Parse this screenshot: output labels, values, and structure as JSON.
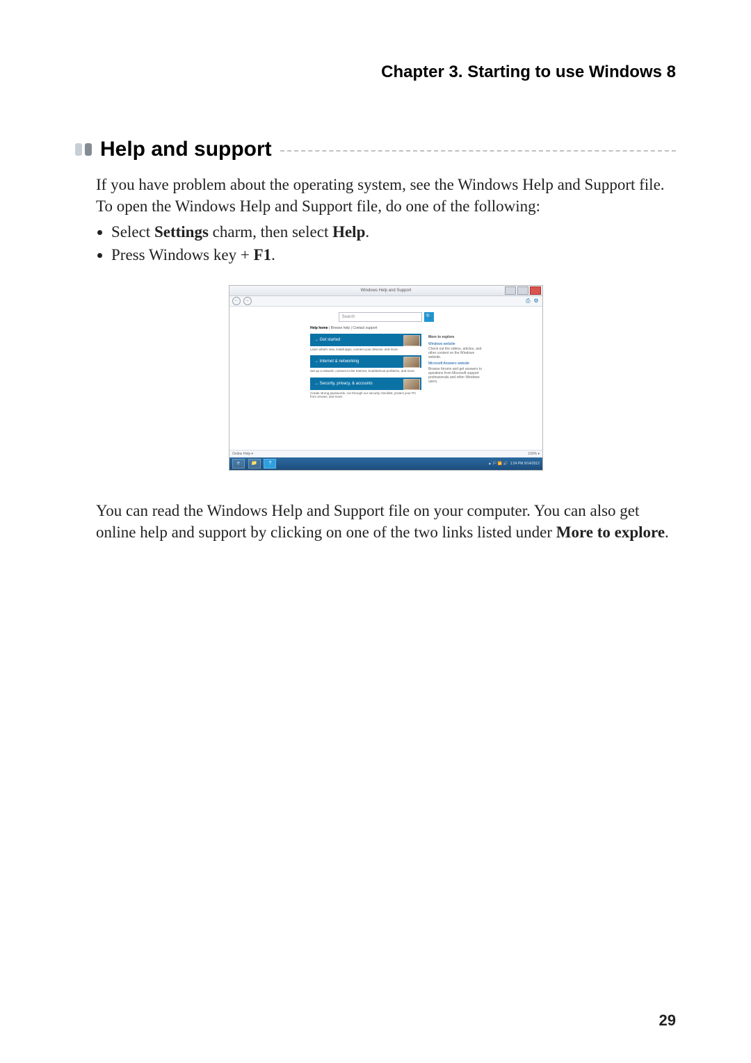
{
  "chapter_title": "Chapter 3. Starting to use Windows 8",
  "section_heading": "Help and support",
  "intro_paragraph": "If you have problem about the operating system, see the Windows Help and Support file. To open the Windows Help and Support file, do one of the following:",
  "bullet1": {
    "pre": "Select ",
    "b1": "Settings",
    "mid": " charm, then select ",
    "b2": "Help",
    "post": "."
  },
  "bullet2": {
    "pre": "Press Windows key + ",
    "b1": "F1",
    "post": "."
  },
  "closing_paragraph": {
    "pre": "You can read the Windows Help and Support file on your computer. You can also get online help and support by clicking on one of the two links listed under ",
    "b1": "More to explore",
    "post": "."
  },
  "page_number": "29",
  "screenshot": {
    "window_title": "Windows Help and Support",
    "search_placeholder": "Search",
    "breadcrumbs": {
      "home": "Help home",
      "rest": " | Browse help | Contact support"
    },
    "tiles": [
      {
        "title": "→ Get started",
        "desc": "Learn what's new, install apps, connect your devices, and more."
      },
      {
        "title": "→ Internet & networking",
        "desc": "Set up a network, connect to the Internet, troubleshoot problems, and more."
      },
      {
        "title": "→ Security, privacy, & accounts",
        "desc": "Create strong passwords, run through our security checklist, protect your PC from viruses, and more."
      }
    ],
    "more": {
      "heading": "More to explore",
      "link1": "Windows website",
      "text1": "Check out the videos, articles, and other content on the Windows website.",
      "link2": "Microsoft Answers website",
      "text2": "Browse forums and get answers to questions from Microsoft support professionals and other Windows users."
    },
    "status_left": "Online Help ▾",
    "status_right": "100% ▾",
    "taskbar": {
      "tray": "▲ 🏳 📶 🔊",
      "clock": "1:24 PM\n9/14/2012"
    }
  }
}
